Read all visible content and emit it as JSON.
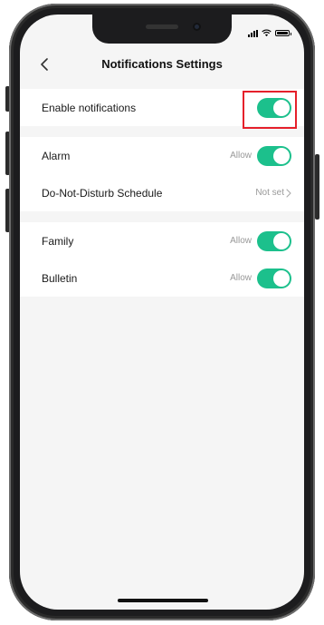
{
  "header": {
    "title": "Notifications Settings",
    "back_icon": "chevron-left-icon"
  },
  "status_bar": {
    "icons": [
      "signal-icon",
      "wifi-icon",
      "battery-icon"
    ]
  },
  "sections": [
    {
      "rows": [
        {
          "label": "Enable notifications",
          "toggle_on": true,
          "highlighted": true
        }
      ]
    },
    {
      "rows": [
        {
          "label": "Alarm",
          "value": "Allow",
          "toggle_on": true
        },
        {
          "label": "Do-Not-Disturb Schedule",
          "value": "Not set",
          "icon": "chevron-right-icon"
        }
      ]
    },
    {
      "rows": [
        {
          "label": "Family",
          "value": "Allow",
          "toggle_on": true
        },
        {
          "label": "Bulletin",
          "value": "Allow",
          "toggle_on": true
        }
      ]
    }
  ],
  "colors": {
    "toggle_on": "#1cc08c",
    "highlight": "#e5202b",
    "screen_bg": "#f5f5f5"
  }
}
